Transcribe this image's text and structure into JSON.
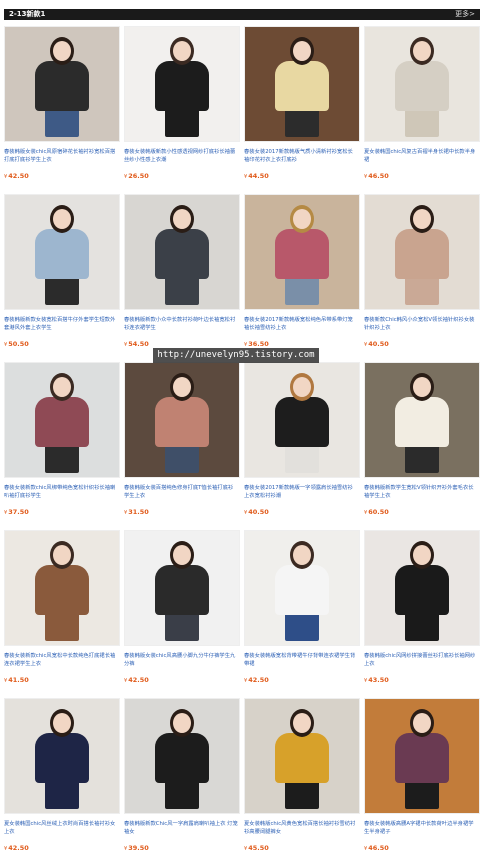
{
  "header": {
    "title": "2-13新款1",
    "more": "更多>"
  },
  "watermark": "http://unevelyn95.tistory.com",
  "products": [
    {
      "desc": "春装韩版女装chic风原宿碎花长袖衬衫宽松百搭打底打底衫学生上衣",
      "price": "42.50",
      "bg": "#cfc6bd",
      "top": "#2b2b2b",
      "bottom": "#3e5a86",
      "hair": "#2a1d16"
    },
    {
      "desc": "春装女装韩版新款小性感透视网纱打底衫长袖蕾丝纱小性感上衣潮",
      "price": "26.50",
      "bg": "#f2f0ee",
      "top": "#1c1c1c",
      "bottom": "#1c1c1c",
      "hair": "#3b2a22"
    },
    {
      "desc": "春装女装2017新款韩版气质小清新衬衫宽松长袖印花衬衣上衣打底衫",
      "price": "44.50",
      "bg": "#6d4b34",
      "top": "#e8d8a2",
      "bottom": "#2c2c2c",
      "hair": "#2a1d16"
    },
    {
      "desc": "夏女装韩国chic风复古百褶半身长裙中长款半身裙",
      "price": "46.50",
      "bg": "#e9e5de",
      "top": "#d5cfc4",
      "bottom": "#cfc7b8",
      "hair": "#3b2a22"
    },
    {
      "desc": "春装韩版新款女装宽松百搭牛仔外套学生短款外套港风外套上衣学生",
      "price": "50.50",
      "bg": "#e4e2df",
      "top": "#9db6cf",
      "bottom": "#2b2b2b",
      "hair": "#2a1d16"
    },
    {
      "desc": "春装韩版新款小众中长款衬衫荷叶边长袖宽松衬衫连衣裙学生",
      "price": "54.50",
      "bg": "#d8d6d2",
      "top": "#3b4048",
      "bottom": "#3b4048",
      "hair": "#2a1d16"
    },
    {
      "desc": "春装女装2017新款韩版宽松纯色吊带系带灯笼袖长袖雪纺衫上衣",
      "price": "36.50",
      "bg": "#c9b49c",
      "top": "#b8586a",
      "bottom": "#7a8fa8",
      "hair": "#b58a44"
    },
    {
      "desc": "春装新款Chic韩风小众宽松V领长袖针织衫女装针织衫上衣",
      "price": "40.50",
      "bg": "#e3dcd3",
      "top": "#c9a48f",
      "bottom": "#caa996",
      "hair": "#2a1d16"
    },
    {
      "desc": "春装女装新款chic风绑带纯色宽松针织衫长袖喇叭袖打底衫学生",
      "price": "37.50",
      "bg": "#dcdede",
      "top": "#8f4a55",
      "bottom": "#2b2b2b",
      "hair": "#3b2a22"
    },
    {
      "desc": "春装韩版女装百搭纯色修身打底T恤长袖打底衫学生上衣",
      "price": "31.50",
      "bg": "#5c4a3e",
      "top": "#c08272",
      "bottom": "#3f4f68",
      "hair": "#2a1d16"
    },
    {
      "desc": "春装女装2017新款韩版一字领露肩长袖雪纺衫上衣宽松衬衫潮",
      "price": "40.50",
      "bg": "#e9e6e1",
      "top": "#1d1d1d",
      "bottom": "#e2e0dc",
      "hair": "#b07840"
    },
    {
      "desc": "春装韩版新款学生宽松V领针织开衫外套毛衣长袖学生上衣",
      "price": "60.50",
      "bg": "#7a7060",
      "top": "#f2ede2",
      "bottom": "#2b2b2b",
      "hair": "#2a1d16"
    },
    {
      "desc": "春装女装新款chic风宽松中长款纯色打底裙长袖连衣裙学生上衣",
      "price": "41.50",
      "bg": "#ece8e2",
      "top": "#8a5a3c",
      "bottom": "#8a5a3c",
      "hair": "#3b2a22"
    },
    {
      "desc": "春装韩版女装chic风高腰小脚九分牛仔裤学生九分裤",
      "price": "42.50",
      "bg": "#f1f1f1",
      "top": "#2a2a2a",
      "bottom": "#3a3e48",
      "hair": "#2a1d16"
    },
    {
      "desc": "春装女装韩版宽松背带裙牛仔背带连衣裙学生背带裙",
      "price": "42.50",
      "bg": "#f0efec",
      "top": "#f5f5f5",
      "bottom": "#2e4e88",
      "hair": "#3b2a22"
    },
    {
      "desc": "春装韩版chic风网纱拼接蕾丝衫打底衫长袖网纱上衣",
      "price": "43.50",
      "bg": "#eae6e3",
      "top": "#1a1a1a",
      "bottom": "#1a1a1a",
      "hair": "#2a1d16"
    },
    {
      "desc": "夏女装韩国chic风丝绒上衣时尚百搭长袖衬衫女上衣",
      "price": "42.50",
      "bg": "#e4e1dc",
      "top": "#1e2546",
      "bottom": "#1e2546",
      "hair": "#2a1d16"
    },
    {
      "desc": "春装韩版新款Chic风一字肩露肩喇叭袖上衣 灯笼袖女",
      "price": "39.50",
      "bg": "#d9d8d5",
      "top": "#1c1c1c",
      "bottom": "#1c1c1c",
      "hair": "#2a1d16"
    },
    {
      "desc": "夏女装韩版chic风黄色宽松百搭长袖衬衫雪纺衬衫高腰阔腿裤女",
      "price": "45.50",
      "bg": "#d7d2c9",
      "top": "#d7a12a",
      "bottom": "#1c1c1c",
      "hair": "#2a1d16"
    },
    {
      "desc": "春装女装韩版高腰A字裙中长款荷叶边半身裙学生半身裙子",
      "price": "46.50",
      "bg": "#c27c3a",
      "top": "#6a3a52",
      "bottom": "#1c1c1c",
      "hair": "#2a1d16"
    }
  ]
}
